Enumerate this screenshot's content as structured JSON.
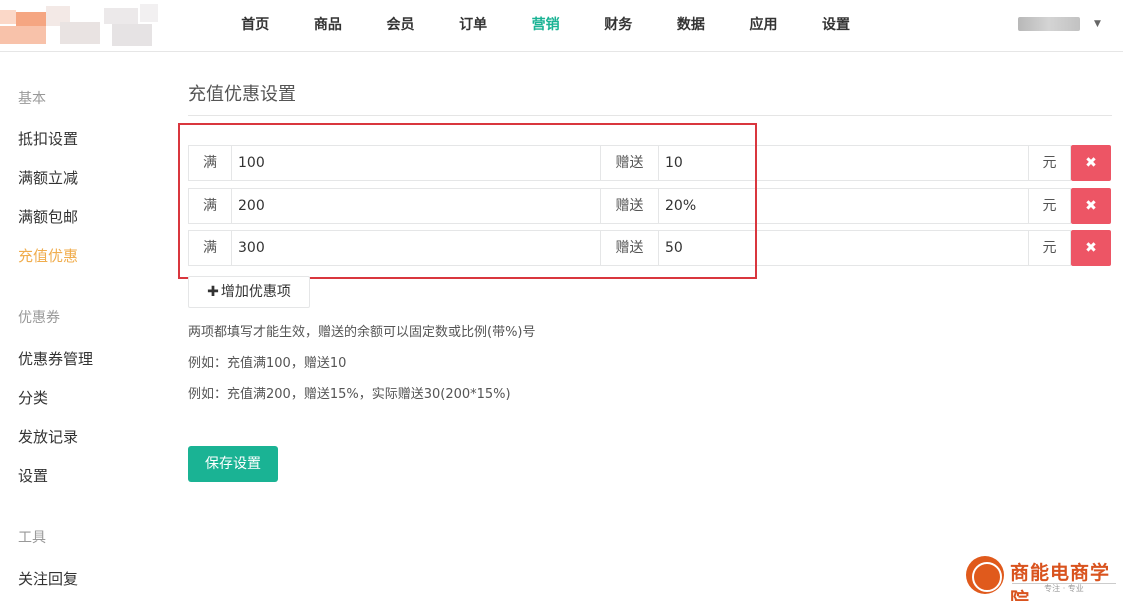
{
  "nav": {
    "items": [
      "首页",
      "商品",
      "会员",
      "订单",
      "营销",
      "财务",
      "数据",
      "应用",
      "设置"
    ],
    "active": "营销"
  },
  "sidebar": {
    "groups": [
      {
        "title": "基本",
        "items": [
          "抵扣设置",
          "满额立减",
          "满额包邮",
          "充值优惠"
        ]
      },
      {
        "title": "优惠券",
        "items": [
          "优惠券管理",
          "分类",
          "发放记录",
          "设置"
        ]
      },
      {
        "title": "工具",
        "items": [
          "关注回复"
        ]
      }
    ],
    "active": "充值优惠"
  },
  "main": {
    "title": "充值优惠设置",
    "rows": [
      {
        "prefix": "满",
        "amount": "100",
        "gift_label": "赠送",
        "gift": "10",
        "unit": "元"
      },
      {
        "prefix": "满",
        "amount": "200",
        "gift_label": "赠送",
        "gift": "20%",
        "unit": "元"
      },
      {
        "prefix": "满",
        "amount": "300",
        "gift_label": "赠送",
        "gift": "50",
        "unit": "元"
      }
    ],
    "delete_icon": "✖",
    "add_button": "增加优惠项",
    "add_icon": "✚",
    "hints": [
      "两项都填写才能生效，赠送的余额可以固定数或比例(带%)号",
      "例如：充值满100，赠送10",
      "例如：充值满200，赠送15%，实际赠送30(200*15%)"
    ],
    "save_button": "保存设置"
  },
  "watermark": {
    "text": "商能电商学院",
    "sub": "专注 · 专业"
  },
  "colors": {
    "accent": "#1ab394",
    "active_sidebar": "#f0ad4e",
    "danger": "#ed5565",
    "highlight": "#d9363e"
  }
}
